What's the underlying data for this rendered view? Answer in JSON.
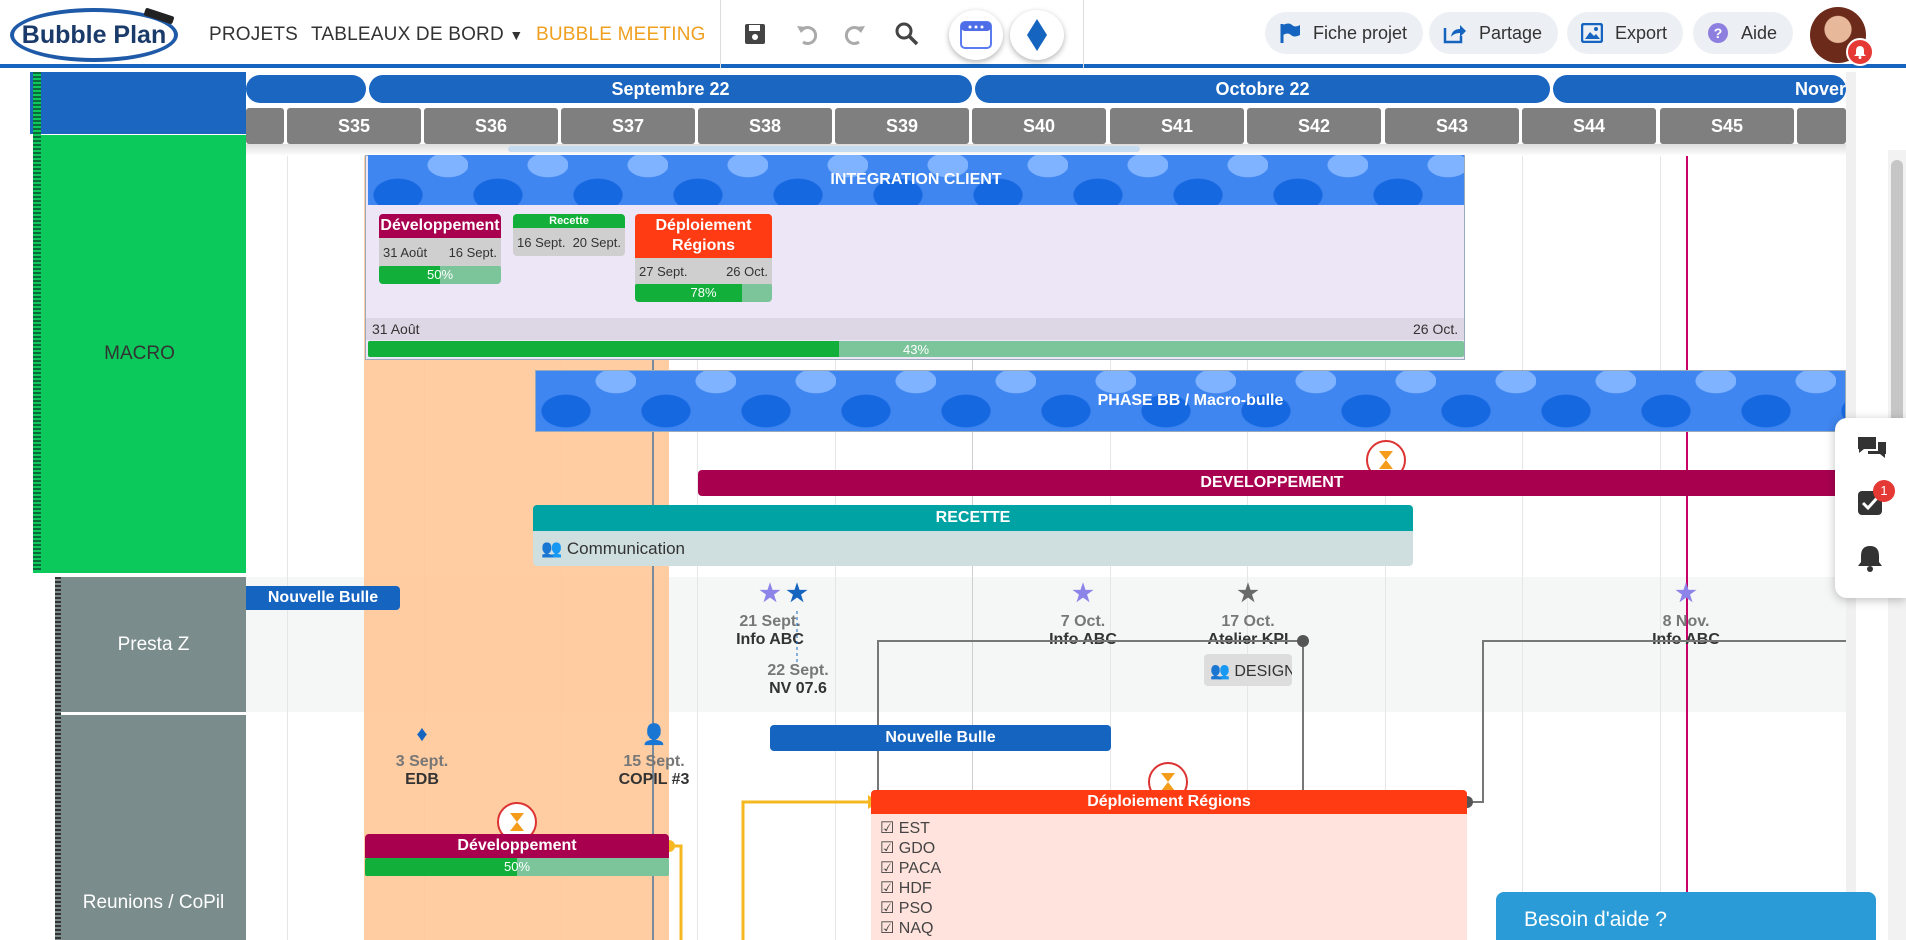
{
  "brand": {
    "logo_text": "Bubble Plan"
  },
  "nav": {
    "projets": "PROJETS",
    "tableaux": "TABLEAUX DE BORD",
    "meeting": "BUBBLE MEETING"
  },
  "toolbar": {
    "fiche": "Fiche projet",
    "partage": "Partage",
    "export": "Export",
    "aide": "Aide"
  },
  "timeline": {
    "months": [
      "Septembre 22",
      "Octobre 22",
      "Nover"
    ],
    "weeks": [
      "S35",
      "S36",
      "S37",
      "S38",
      "S39",
      "S40",
      "S41",
      "S42",
      "S43",
      "S44",
      "S45"
    ]
  },
  "rows": {
    "macro": "MACRO",
    "presta": "Presta Z",
    "reunions": "Reunions / CoPil"
  },
  "macro": {
    "integration": "INTEGRATION CLIENT",
    "integration_start": "31 Août",
    "integration_end": "26 Oct.",
    "integration_progress": "43%",
    "dev": {
      "title": "Développement",
      "start": "31 Août",
      "end": "16 Sept.",
      "progress": "50%"
    },
    "recette": {
      "title": "Recette",
      "start": "16 Sept.",
      "end": "20 Sept."
    },
    "deploy": {
      "title_line1": "Déploiement",
      "title_line2": "Régions",
      "start": "27 Sept.",
      "end": "26 Oct.",
      "progress": "78%"
    },
    "phase": "PHASE BB / Macro-bulle",
    "developpement": "DEVELOPPEMENT",
    "recette_bar": "RECETTE",
    "communication": "Communication"
  },
  "presta": {
    "nouvelle": "Nouvelle Bulle",
    "m1_date": "21 Sept.",
    "m1_label": "Info ABC",
    "m2_date": "22 Sept.",
    "m2_label": "NV 07.6",
    "m3_date": "7 Oct.",
    "m3_label": "Info ABC",
    "m4_date": "17 Oct.",
    "m4_label": "Atelier KPI",
    "m4_tag": "DESIGN",
    "m5_date": "8 Nov.",
    "m5_label": "Info ABC"
  },
  "reunions": {
    "r1_date": "3 Sept.",
    "r1_label": "EDB",
    "r2_date": "15 Sept.",
    "r2_label": "COPIL #3",
    "nouvelle": "Nouvelle Bulle",
    "deploy": "Déploiement Régions",
    "checks": [
      "EST",
      "GDO",
      "PACA",
      "HDF",
      "PSO",
      "NAQ"
    ],
    "dev": "Développement",
    "dev_progress": "50%"
  },
  "side": {
    "notif_count": "1"
  },
  "help": {
    "label": "Besoin d'aide ?"
  },
  "colors": {
    "brand_blue": "#1565c0",
    "accent": "#f0a020",
    "macro_green": "#0bc95a",
    "grey_row": "#7a8c8c",
    "magenta": "#a8004f",
    "teal": "#00a3a3",
    "red": "#ff3b14"
  },
  "chart_data": {
    "progress": {
      "integration": 43,
      "dev": 50,
      "deploy": 78,
      "reunion_dev": 50
    }
  }
}
